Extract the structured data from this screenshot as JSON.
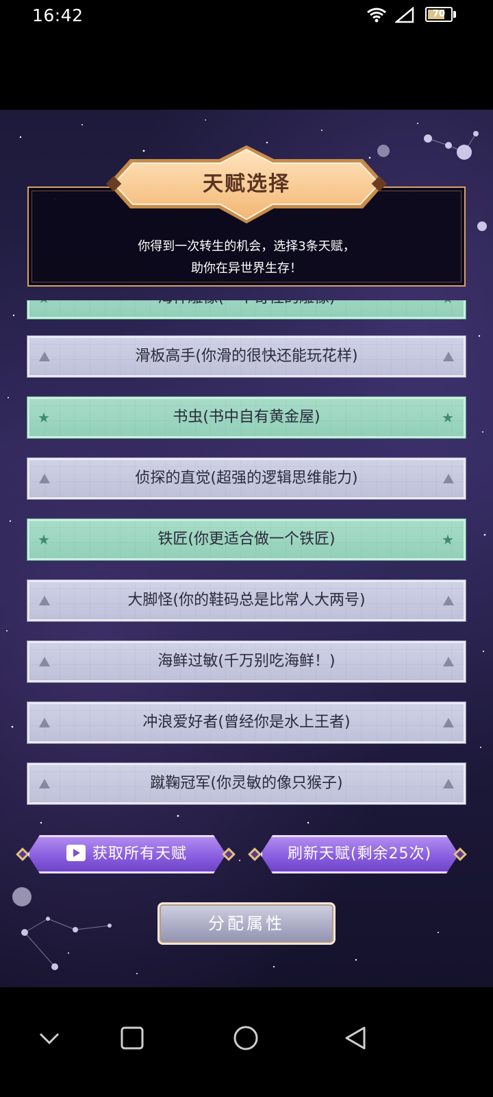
{
  "status_bar": {
    "time": "16:42",
    "battery": "70"
  },
  "header": {
    "title": "天赋选择",
    "intro_line1": "你得到一次转生的机会，选择3条天赋，",
    "intro_line2": "助你在异世界生存！"
  },
  "talents": [
    {
      "label": "海神雕像(一个奇怪的雕像)",
      "rarity": "green"
    },
    {
      "label": "滑板高手(你滑的很快还能玩花样)",
      "rarity": "common"
    },
    {
      "label": "书虫(书中自有黄金屋)",
      "rarity": "green"
    },
    {
      "label": "侦探的直觉(超强的逻辑思维能力)",
      "rarity": "common"
    },
    {
      "label": "铁匠(你更适合做一个铁匠)",
      "rarity": "green"
    },
    {
      "label": "大脚怪(你的鞋码总是比常人大两号)",
      "rarity": "common"
    },
    {
      "label": "海鲜过敏(千万别吃海鲜！)",
      "rarity": "common"
    },
    {
      "label": "冲浪爱好者(曾经你是水上王者)",
      "rarity": "common"
    },
    {
      "label": "蹴鞠冠军(你灵敏的像只猴子)",
      "rarity": "common"
    }
  ],
  "buttons": {
    "get_all": "获取所有天赋",
    "refresh": "刷新天赋(剩余25次)",
    "allocate": "分配属性"
  },
  "colors": {
    "panel_border": "#d8a265",
    "common_card": "#c7c9e0",
    "green_card": "#9dd6c0",
    "purple_button": "#8a5fe0"
  }
}
